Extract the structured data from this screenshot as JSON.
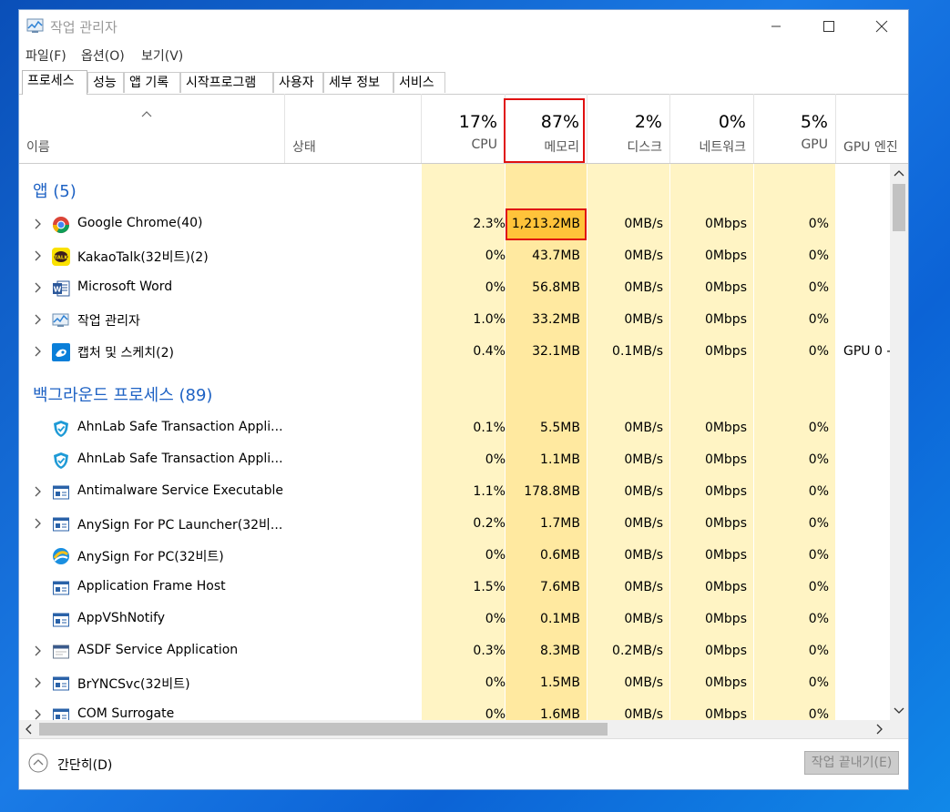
{
  "window": {
    "title": "작업 관리자"
  },
  "menu": [
    "파일(F)",
    "옵션(O)",
    "보기(V)"
  ],
  "tabs": [
    "프로세스",
    "성능",
    "앱 기록",
    "시작프로그램",
    "사용자",
    "세부 정보",
    "서비스"
  ],
  "header": {
    "name_label": "이름",
    "status_label": "상태",
    "cpu": {
      "pct": "17%",
      "label": "CPU"
    },
    "memory": {
      "pct": "87%",
      "label": "메모리"
    },
    "disk": {
      "pct": "2%",
      "label": "디스크"
    },
    "network": {
      "pct": "0%",
      "label": "네트워크"
    },
    "gpu": {
      "pct": "5%",
      "label": "GPU"
    },
    "gpu_engine_label": "GPU 엔진"
  },
  "groups": {
    "apps": "앱 (5)",
    "background": "백그라운드 프로세스 (89)"
  },
  "apps": [
    {
      "name": "Google Chrome(40)",
      "cpu": "2.3%",
      "mem": "1,213.2MB",
      "disk": "0MB/s",
      "net": "0Mbps",
      "gpu": "0%",
      "icon": "chrome-icon"
    },
    {
      "name": "KakaoTalk(32비트)(2)",
      "cpu": "0%",
      "mem": "43.7MB",
      "disk": "0MB/s",
      "net": "0Mbps",
      "gpu": "0%",
      "icon": "kakaotalk-icon",
      "icon_text": "TALK"
    },
    {
      "name": "Microsoft Word",
      "cpu": "0%",
      "mem": "56.8MB",
      "disk": "0MB/s",
      "net": "0Mbps",
      "gpu": "0%",
      "icon": "word-icon",
      "icon_text": "W"
    },
    {
      "name": "작업 관리자",
      "cpu": "1.0%",
      "mem": "33.2MB",
      "disk": "0MB/s",
      "net": "0Mbps",
      "gpu": "0%",
      "icon": "task-manager-icon"
    },
    {
      "name": "캡처 및 스케치(2)",
      "cpu": "0.4%",
      "mem": "32.1MB",
      "disk": "0.1MB/s",
      "net": "0Mbps",
      "gpu": "0%",
      "gpu_engine": "GPU 0 -",
      "icon": "snip-sketch-icon"
    }
  ],
  "background": [
    {
      "name": "AhnLab Safe Transaction Appli...",
      "cpu": "0.1%",
      "mem": "5.5MB",
      "disk": "0MB/s",
      "net": "0Mbps",
      "gpu": "0%",
      "icon": "ahnlab-shield-icon",
      "expand": false
    },
    {
      "name": "AhnLab Safe Transaction Appli...",
      "cpu": "0%",
      "mem": "1.1MB",
      "disk": "0MB/s",
      "net": "0Mbps",
      "gpu": "0%",
      "icon": "ahnlab-shield-icon",
      "expand": false
    },
    {
      "name": "Antimalware Service Executable",
      "cpu": "1.1%",
      "mem": "178.8MB",
      "disk": "0MB/s",
      "net": "0Mbps",
      "gpu": "0%",
      "icon": "service-window-icon",
      "expand": true
    },
    {
      "name": "AnySign For PC Launcher(32비...",
      "cpu": "0.2%",
      "mem": "1.7MB",
      "disk": "0MB/s",
      "net": "0Mbps",
      "gpu": "0%",
      "icon": "service-window-icon",
      "expand": true
    },
    {
      "name": "AnySign For PC(32비트)",
      "cpu": "0%",
      "mem": "0.6MB",
      "disk": "0MB/s",
      "net": "0Mbps",
      "gpu": "0%",
      "icon": "anysign-icon",
      "expand": false
    },
    {
      "name": "Application Frame Host",
      "cpu": "1.5%",
      "mem": "7.6MB",
      "disk": "0MB/s",
      "net": "0Mbps",
      "gpu": "0%",
      "icon": "service-window-icon",
      "expand": false
    },
    {
      "name": "AppVShNotify",
      "cpu": "0%",
      "mem": "0.1MB",
      "disk": "0MB/s",
      "net": "0Mbps",
      "gpu": "0%",
      "icon": "service-window-icon",
      "expand": false
    },
    {
      "name": "ASDF Service Application",
      "cpu": "0.3%",
      "mem": "8.3MB",
      "disk": "0.2MB/s",
      "net": "0Mbps",
      "gpu": "0%",
      "icon": "asdf-service-icon",
      "expand": true
    },
    {
      "name": "BrYNCSvc(32비트)",
      "cpu": "0%",
      "mem": "1.5MB",
      "disk": "0MB/s",
      "net": "0Mbps",
      "gpu": "0%",
      "icon": "service-window-icon",
      "expand": true
    },
    {
      "name": "COM Surrogate",
      "cpu": "0%",
      "mem": "1.6MB",
      "disk": "0MB/s",
      "net": "0Mbps",
      "gpu": "0%",
      "icon": "service-window-icon",
      "expand": true
    }
  ],
  "footer": {
    "simpler": "간단히(D)",
    "end_task": "작업 끝내기(E)"
  },
  "colors": {
    "group_blue": "#1e62c4",
    "heat_low": "#fff4c4",
    "heat_mid": "#ffe9a0",
    "heat_high": "#ffc33a",
    "highlight_red": "#e01010"
  }
}
